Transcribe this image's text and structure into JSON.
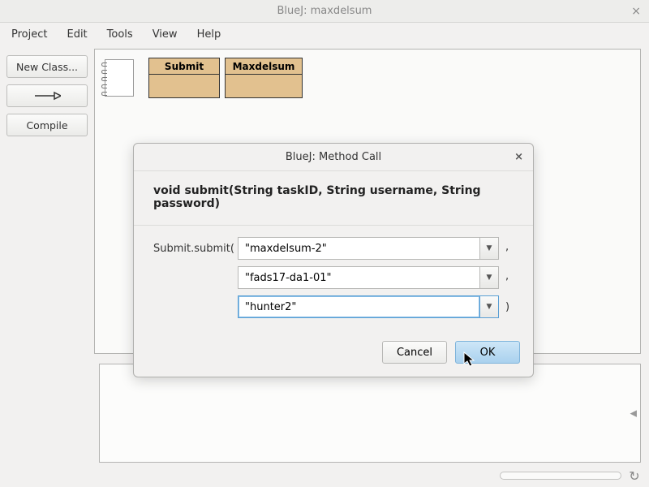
{
  "window": {
    "title": "BlueJ:  maxdelsum"
  },
  "menu": {
    "project": "Project",
    "edit": "Edit",
    "tools": "Tools",
    "view": "View",
    "help": "Help"
  },
  "sidebar": {
    "new_class": "New Class...",
    "compile": "Compile"
  },
  "classes": {
    "c1": "Submit",
    "c2": "Maxdelsum"
  },
  "dialog": {
    "title": "BlueJ:  Method Call",
    "signature": "void submit(String taskID, String username, String password)",
    "call_prefix": "Submit.submit(",
    "params": [
      {
        "value": "\"maxdelsum-2\""
      },
      {
        "value": "\"fads17-da1-01\""
      },
      {
        "value": "\"hunter2\""
      }
    ],
    "close_paren": ")",
    "cancel": "Cancel",
    "ok": "OK"
  }
}
